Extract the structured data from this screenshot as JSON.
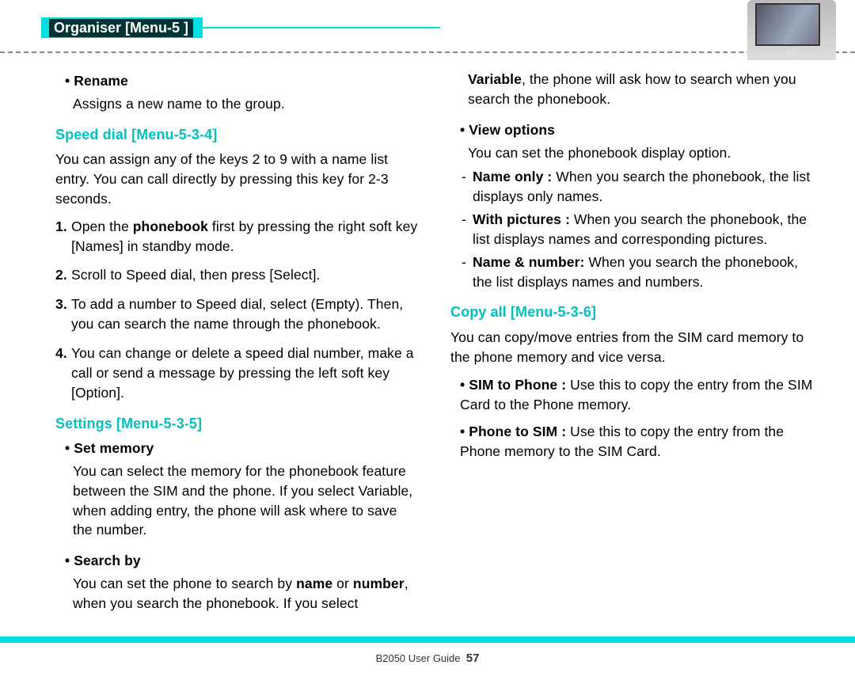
{
  "header": {
    "title": "Organiser [Menu-5 ]"
  },
  "col_left": {
    "rename_label": "Rename",
    "rename_desc": "Assigns a new name to the group.",
    "speeddial_title": "Speed dial [Menu-5-3-4]",
    "speeddial_para": "You can assign any of the keys 2 to 9 with a name list entry. You can call directly by pressing this key for 2-3 seconds.",
    "step1_pre": "Open the ",
    "step1_bold": "phonebook",
    "step1_post": " first by pressing the right soft key [Names] in standby mode.",
    "step2": "Scroll to Speed dial, then press [Select].",
    "step3": "To add a number to Speed dial, select (Empty). Then, you can search the name through the phonebook.",
    "step4": "You can change or delete a speed dial number, make a call or send a message by pressing the left soft key [Option].",
    "settings_title": "Settings [Menu-5-3-5]",
    "setmem_label": "Set memory",
    "setmem_desc": "You can select the memory for the phonebook feature between the SIM and the phone. If you select Variable, when adding entry, the phone will ask where to save the number."
  },
  "col_right": {
    "search_label": "Search by",
    "search_pre1": "You can set the phone to search by ",
    "search_b1": "name",
    "search_mid1": " or ",
    "search_b2": "number",
    "search_post1": ", when you search the phonebook. If you select ",
    "search_b3": "Variable",
    "search_post2": ", the phone will ask how to search when you search the phonebook.",
    "view_label": "View options",
    "view_desc": "You can set the phonebook display option.",
    "opt1_bold": "Name only :",
    "opt1_rest": " When you search the phonebook, the list displays only names.",
    "opt2_bold": "With pictures :",
    "opt2_rest": " When you search the phonebook, the list displays names and corresponding pictures.",
    "opt3_bold": "Name & number:",
    "opt3_rest": " When you search the phonebook, the list displays names and numbers.",
    "copyall_title": "Copy all [Menu-5-3-6]",
    "copyall_para": "You can copy/move entries from the SIM card memory to the phone memory and vice versa.",
    "sim2phone_bold": "SIM to Phone :",
    "sim2phone_rest": " Use this to copy the entry from the SIM Card to the Phone memory.",
    "phone2sim_bold": "Phone to SIM :",
    "phone2sim_rest": " Use this to copy the entry from the Phone memory to the SIM Card."
  },
  "footer": {
    "guide": "B2050 User Guide",
    "page": "57"
  },
  "phone": {
    "brand": "LG"
  }
}
